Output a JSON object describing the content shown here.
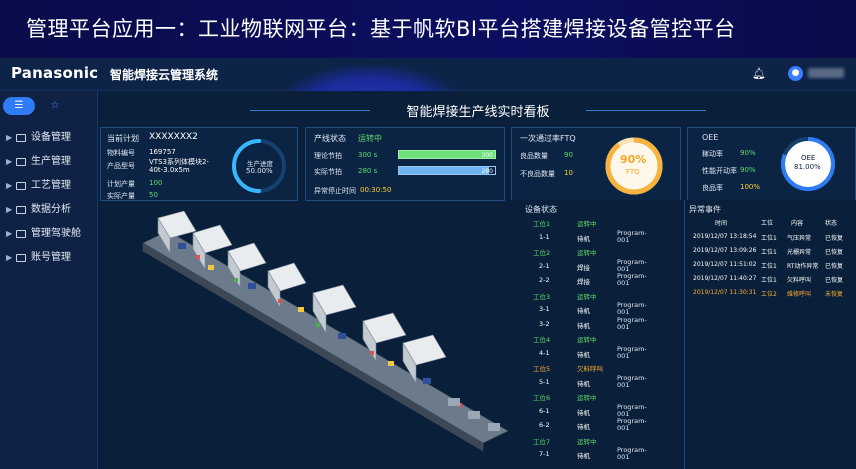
{
  "slide_title": "管理平台应用一：工业物联网平台：基于帆软BI平台搭建焊接设备管控平台",
  "header": {
    "brand": "Panasonic",
    "system_name": "智能焊接云管理系统",
    "bell_icon": "bell-icon",
    "user_icon": "user-avatar-icon"
  },
  "sidebar": {
    "tabs": [
      {
        "icon": "list-icon",
        "glyph": "☰"
      },
      {
        "icon": "star-icon",
        "glyph": "☆"
      }
    ],
    "items": [
      {
        "label": "设备管理"
      },
      {
        "label": "生产管理"
      },
      {
        "label": "工艺管理"
      },
      {
        "label": "数据分析"
      },
      {
        "label": "管理驾驶舱"
      },
      {
        "label": "账号管理"
      }
    ]
  },
  "dashboard": {
    "title": "智能焊接生产线实时看板",
    "plan": {
      "title_label": "当前计划",
      "plan_value": "XXXXXXX2",
      "rows": [
        {
          "label": "物料编号",
          "value": "169757"
        },
        {
          "label": "产品型号",
          "value": "VTS3系列体模块2-40t-3.0x5m"
        },
        {
          "label": "计划产量",
          "value": "100"
        },
        {
          "label": "实际产量",
          "value": "50"
        }
      ],
      "gauge_label": "生产进度",
      "gauge_value": "50.00%",
      "gauge_fraction": 0.5,
      "colors": {
        "accent": "#38b6ff",
        "green": "#5fdc6a"
      }
    },
    "line": {
      "status_label": "产线状态",
      "status_value": "运转中",
      "theory_label": "理论节拍",
      "theory_value": "300 s",
      "theory_bar_label": "300",
      "actual_label": "实际节拍",
      "actual_value": "280 s",
      "actual_bar_label": "280",
      "stop_label": "异常停止时间",
      "stop_value": "00:30:50"
    },
    "pass": {
      "title": "一次通过率FTQ",
      "good_label": "良品数量",
      "good_value": "90",
      "bad_label": "不良品数量",
      "bad_value": "10",
      "gauge_value": "90%",
      "gauge_label": "FTQ",
      "gauge_fraction": 0.9
    },
    "oee": {
      "title": "OEE",
      "rows": [
        {
          "label": "稼动率",
          "value": "90%"
        },
        {
          "label": "性能开动率",
          "value": "90%"
        },
        {
          "label": "良品率",
          "value": "100%"
        }
      ],
      "gauge_label": "OEE",
      "gauge_value": "81.00%",
      "gauge_fraction": 0.81
    },
    "equipment": {
      "title": "设备状态",
      "rows": [
        {
          "station": "工位1",
          "type": "station",
          "status": "运转中"
        },
        {
          "id": "1-1",
          "status": "待机",
          "program": "Program-001"
        },
        {
          "station": "工位2",
          "type": "station",
          "status": "运转中"
        },
        {
          "id": "2-1",
          "status": "焊接",
          "program": "Program-001"
        },
        {
          "id": "2-2",
          "status": "焊接",
          "program": "Program-001"
        },
        {
          "station": "工位3",
          "type": "station",
          "status": "运转中"
        },
        {
          "id": "3-1",
          "status": "待机",
          "program": "Program-001"
        },
        {
          "id": "3-2",
          "status": "待机",
          "program": "Program-001"
        },
        {
          "station": "工位4",
          "type": "station",
          "status": "运转中"
        },
        {
          "id": "4-1",
          "status": "待机",
          "program": "Program-001"
        },
        {
          "station": "工位5",
          "type": "station-alarm",
          "status": "欠料呼叫"
        },
        {
          "id": "5-1",
          "status": "待机",
          "program": "Program-001"
        },
        {
          "station": "工位6",
          "type": "station",
          "status": "运转中"
        },
        {
          "id": "6-1",
          "status": "待机",
          "program": "Program-001"
        },
        {
          "id": "6-2",
          "status": "待机",
          "program": "Program-001"
        },
        {
          "station": "工位7",
          "type": "station",
          "status": "运转中"
        },
        {
          "id": "7-1",
          "status": "待机",
          "program": "Program-001"
        }
      ]
    },
    "events": {
      "title": "异常事件",
      "headers": [
        "时间",
        "工位",
        "内容",
        "状态"
      ],
      "rows": [
        {
          "time": "2019/12/07 13:18:54",
          "station": "工位1",
          "content": "气压异常",
          "state": "已恢复",
          "alert": false
        },
        {
          "time": "2019/12/07 13:09:26",
          "station": "工位1",
          "content": "光栅异常",
          "state": "已恢复",
          "alert": false
        },
        {
          "time": "2019/12/07 11:51:02",
          "station": "工位1",
          "content": "RT动作异常",
          "state": "已恢复",
          "alert": false
        },
        {
          "time": "2019/12/07 11:40:27",
          "station": "工位1",
          "content": "欠料呼叫",
          "state": "已恢复",
          "alert": false
        },
        {
          "time": "2019/12/07 11:30:31",
          "station": "工位2",
          "content": "维修呼叫",
          "state": "未恢复",
          "alert": true
        }
      ]
    }
  }
}
